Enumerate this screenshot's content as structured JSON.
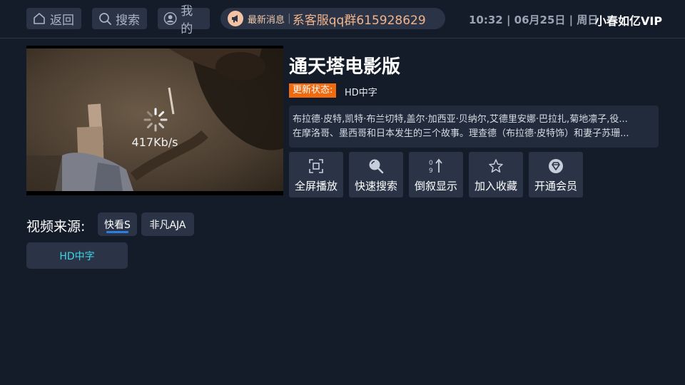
{
  "header": {
    "back_label": "返回",
    "search_label": "搜索",
    "mine_label": "我的",
    "news_label": "最新消息",
    "news_text": "系客服qq群615928629",
    "clock": "10:32 | 06月25日 | 周日",
    "user": "小春如亿VIP"
  },
  "player": {
    "speed": "417Kb/s"
  },
  "detail": {
    "title": "通天塔电影版",
    "status_tag": "更新状态:",
    "status_value": "HD中字",
    "desc_line1": "布拉德·皮特,凯特·布兰切特,盖尔·加西亚·贝纳尔,艾德里安娜·巴拉扎,菊地凛子,役...",
    "desc_line2": "在摩洛哥、墨西哥和日本发生的三个故事。理查德（布拉德·皮特饰）和妻子苏珊..."
  },
  "actions": {
    "fullscreen": "全屏播放",
    "quick_search": "快速搜索",
    "reverse_order": "倒叙显示",
    "favorite": "加入收藏",
    "vip": "开通会员"
  },
  "sources": {
    "label": "视频来源:",
    "items": [
      "快看S",
      "非凡AJA"
    ],
    "selected_index": 0
  },
  "episodes": [
    "HD中字"
  ],
  "colors": {
    "background": "#141c2a",
    "button": "#2a3446",
    "accent_orange": "#f06a10",
    "episode_text": "#3cd6e8",
    "source_underline": "#2e7de0"
  }
}
